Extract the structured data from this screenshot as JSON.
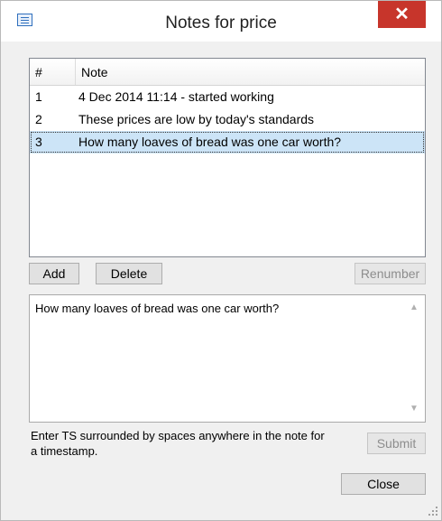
{
  "window": {
    "title": "Notes for price",
    "close_glyph": "✕"
  },
  "list": {
    "headers": {
      "num": "#",
      "note": "Note"
    },
    "rows": [
      {
        "num": "1",
        "note": "4 Dec 2014 11:14 - started working"
      },
      {
        "num": "2",
        "note": "These prices are low by today's standards"
      },
      {
        "num": "3",
        "note": "How many loaves of bread was one car worth?"
      }
    ],
    "selected_index": 2
  },
  "buttons": {
    "add": "Add",
    "delete": "Delete",
    "renumber": "Renumber",
    "submit": "Submit",
    "close": "Close"
  },
  "editor": {
    "value": "How many loaves of bread was one car worth?"
  },
  "hint": "Enter TS surrounded by spaces anywhere in the note for a timestamp.",
  "colors": {
    "selection": "#cce4f7",
    "close_button": "#c7352b"
  },
  "icons": {
    "app": "form-icon",
    "scroll_up": "scroll-up-arrow",
    "scroll_down": "scroll-down-arrow",
    "grip": "resize-grip"
  }
}
